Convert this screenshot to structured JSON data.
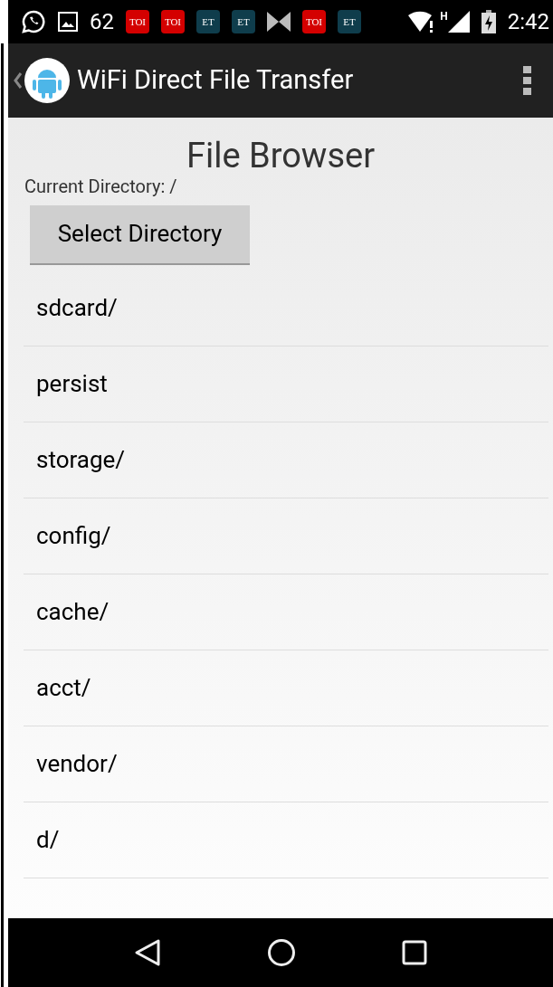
{
  "status_bar": {
    "notifications": [
      {
        "kind": "whatsapp"
      },
      {
        "kind": "image"
      },
      {
        "kind": "text",
        "label": "62"
      },
      {
        "kind": "badge",
        "label": "TOI",
        "color": "#d40000"
      },
      {
        "kind": "badge",
        "label": "TOI",
        "color": "#d40000"
      },
      {
        "kind": "badge",
        "label": "ET",
        "color": "#0f3d4c"
      },
      {
        "kind": "badge",
        "label": "ET",
        "color": "#0f3d4c"
      },
      {
        "kind": "bowtie"
      },
      {
        "kind": "badge",
        "label": "TOI",
        "color": "#d40000"
      },
      {
        "kind": "badge",
        "label": "ET",
        "color": "#0f3d4c"
      }
    ],
    "network_type": "H",
    "time": "2:42"
  },
  "app_bar": {
    "title": "WiFi Direct File Transfer"
  },
  "content": {
    "title": "File Browser",
    "current_directory": "Current Directory: /",
    "button": "Select Directory",
    "items": [
      "sdcard/",
      "persist",
      "storage/",
      "config/",
      "cache/",
      "acct/",
      "vendor/",
      "d/"
    ]
  }
}
